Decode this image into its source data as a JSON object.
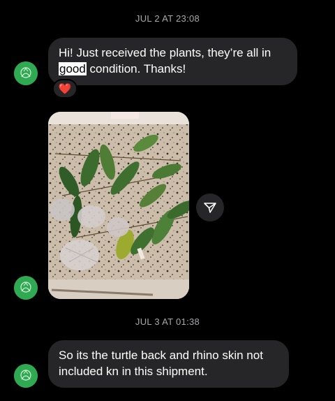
{
  "thread": {
    "timestamps": [
      "JUL 2 AT 23:08",
      "JUL 3 AT 01:38"
    ],
    "messages": [
      {
        "text_before": "Hi! Just received the plants, they’re all in ",
        "highlighted": "good",
        "text_after": " condition. Thanks!",
        "reaction": "❤️"
      },
      {
        "image": "photo of plant cuttings with wrapped root bundles on granite countertop"
      },
      {
        "text": "So its the turtle back and rhino skin not included kn in this shipment."
      }
    ]
  },
  "colors": {
    "background": "#000000",
    "bubble": "#262628",
    "timestamp": "#a9a9ad",
    "avatar": "#2faa52",
    "heart": "#ff2d4a"
  },
  "icons": {
    "share": "share-icon",
    "avatar": "avatar-icon"
  }
}
